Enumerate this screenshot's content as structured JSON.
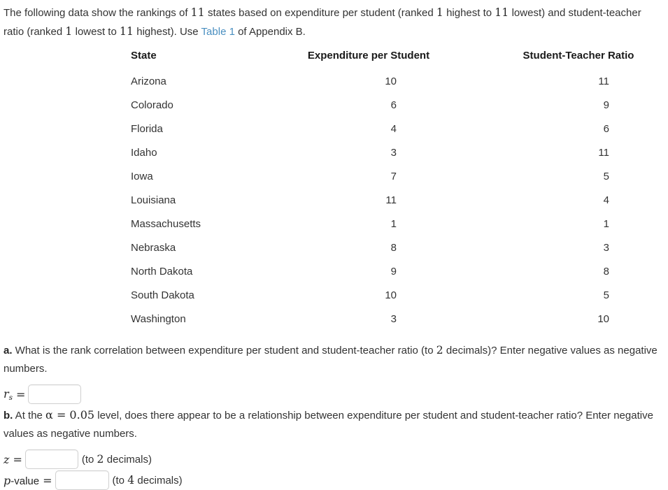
{
  "intro": {
    "part1": "The following data show the rankings of ",
    "n1": "11",
    "part2": " states based on expenditure per student (ranked ",
    "n2": "1",
    "part3": " highest to ",
    "n3": "11",
    "part4": " lowest) and student-teacher ratio (ranked ",
    "n4": "1",
    "part5": " lowest to ",
    "n5": "11",
    "part6": " highest). Use ",
    "link_text": "Table 1",
    "part7": " of Appendix B.",
    "link_color": "#4a8fc0"
  },
  "table": {
    "headers": [
      "State",
      "Expenditure per Student",
      "Student-Teacher Ratio"
    ],
    "rows": [
      {
        "state": "Arizona",
        "expenditure": "10",
        "ratio": "11"
      },
      {
        "state": "Colorado",
        "expenditure": "6",
        "ratio": "9"
      },
      {
        "state": "Florida",
        "expenditure": "4",
        "ratio": "6"
      },
      {
        "state": "Idaho",
        "expenditure": "3",
        "ratio": "11"
      },
      {
        "state": "Iowa",
        "expenditure": "7",
        "ratio": "5"
      },
      {
        "state": "Louisiana",
        "expenditure": "11",
        "ratio": "4"
      },
      {
        "state": "Massachusetts",
        "expenditure": "1",
        "ratio": "1"
      },
      {
        "state": "Nebraska",
        "expenditure": "8",
        "ratio": "3"
      },
      {
        "state": "North Dakota",
        "expenditure": "9",
        "ratio": "8"
      },
      {
        "state": "South Dakota",
        "expenditure": "10",
        "ratio": "5"
      },
      {
        "state": "Washington",
        "expenditure": "3",
        "ratio": "10"
      }
    ]
  },
  "part_a": {
    "label": "a.",
    "text1": " What is the rank correlation between expenditure per student and student-teacher ratio (to ",
    "decimals": "2",
    "text2": " decimals)? Enter negative values as negative numbers.",
    "rs_symbol_main": "r",
    "rs_symbol_sub": "s",
    "equals": "=",
    "rs_value": "",
    "rs_placeholder": ""
  },
  "part_b": {
    "label": "b.",
    "text1": " At the ",
    "alpha": "α = 0.05",
    "text2": " level, does there appear to be a relationship between expenditure per student and student-teacher ratio? Enter negative values as negative numbers.",
    "z_symbol": "z",
    "equals": "=",
    "z_value": "",
    "z_placeholder": "",
    "z_hint_pre": "(to ",
    "z_hint_num": "2",
    "z_hint_post": " decimals)",
    "p_symbol_italic": "p",
    "p_symbol_rest": "-value",
    "p_value": "",
    "p_placeholder": "",
    "p_hint_pre": "(to ",
    "p_hint_num": "4",
    "p_hint_post": " decimals)"
  }
}
